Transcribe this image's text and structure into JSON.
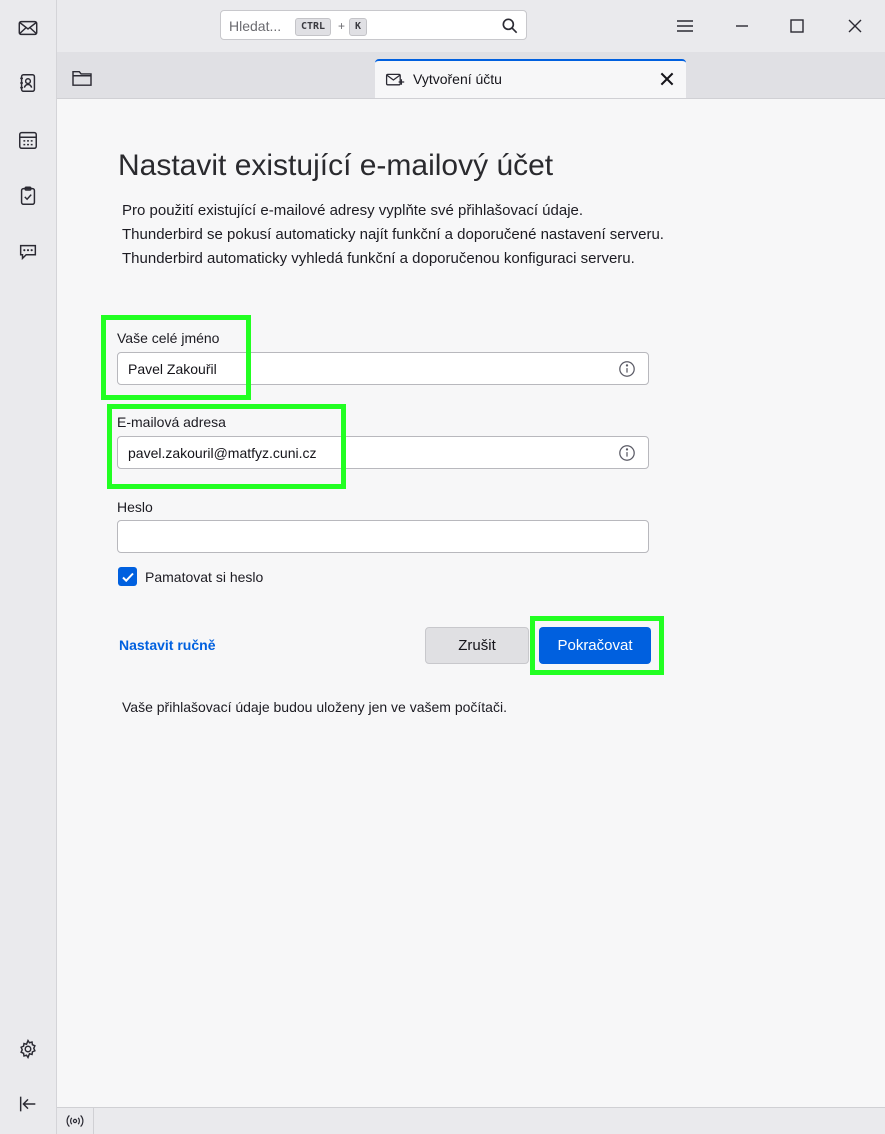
{
  "spaces": {
    "items": [
      {
        "name": "mail-icon"
      },
      {
        "name": "address-book-icon"
      },
      {
        "name": "calendar-icon"
      },
      {
        "name": "tasks-icon"
      },
      {
        "name": "chat-icon"
      }
    ],
    "bottom": [
      {
        "name": "settings-icon"
      },
      {
        "name": "collapse-sidebar-icon"
      }
    ]
  },
  "titlebar": {
    "search_placeholder": "Hledat...",
    "shortcut_key1": "CTRL",
    "shortcut_plus": "+",
    "shortcut_key2": "K"
  },
  "tab": {
    "label": "Vytvoření účtu"
  },
  "page": {
    "title": "Nastavit existující e-mailový účet",
    "description": [
      "Pro použití existující e-mailové adresy vyplňte své přihlašovací údaje.",
      "Thunderbird se pokusí automaticky najít funkční a doporučené nastavení serveru.",
      "Thunderbird automaticky vyhledá funkční a doporučenou konfiguraci serveru."
    ],
    "name_label": "Vaše celé jméno",
    "name_value": "Pavel Zakouřil",
    "email_label": "E-mailová adresa",
    "email_value": "pavel.zakouril@matfyz.cuni.cz",
    "password_label": "Heslo",
    "password_value": "",
    "remember_label": "Pamatovat si heslo",
    "remember_checked": true,
    "manual_link": "Nastavit ručně",
    "cancel_label": "Zrušit",
    "continue_label": "Pokračovat",
    "footnote": "Vaše přihlašovací údaje budou uloženy jen ve vašem počítači."
  },
  "colors": {
    "accent": "#0060df",
    "highlight": "#22ff22"
  }
}
